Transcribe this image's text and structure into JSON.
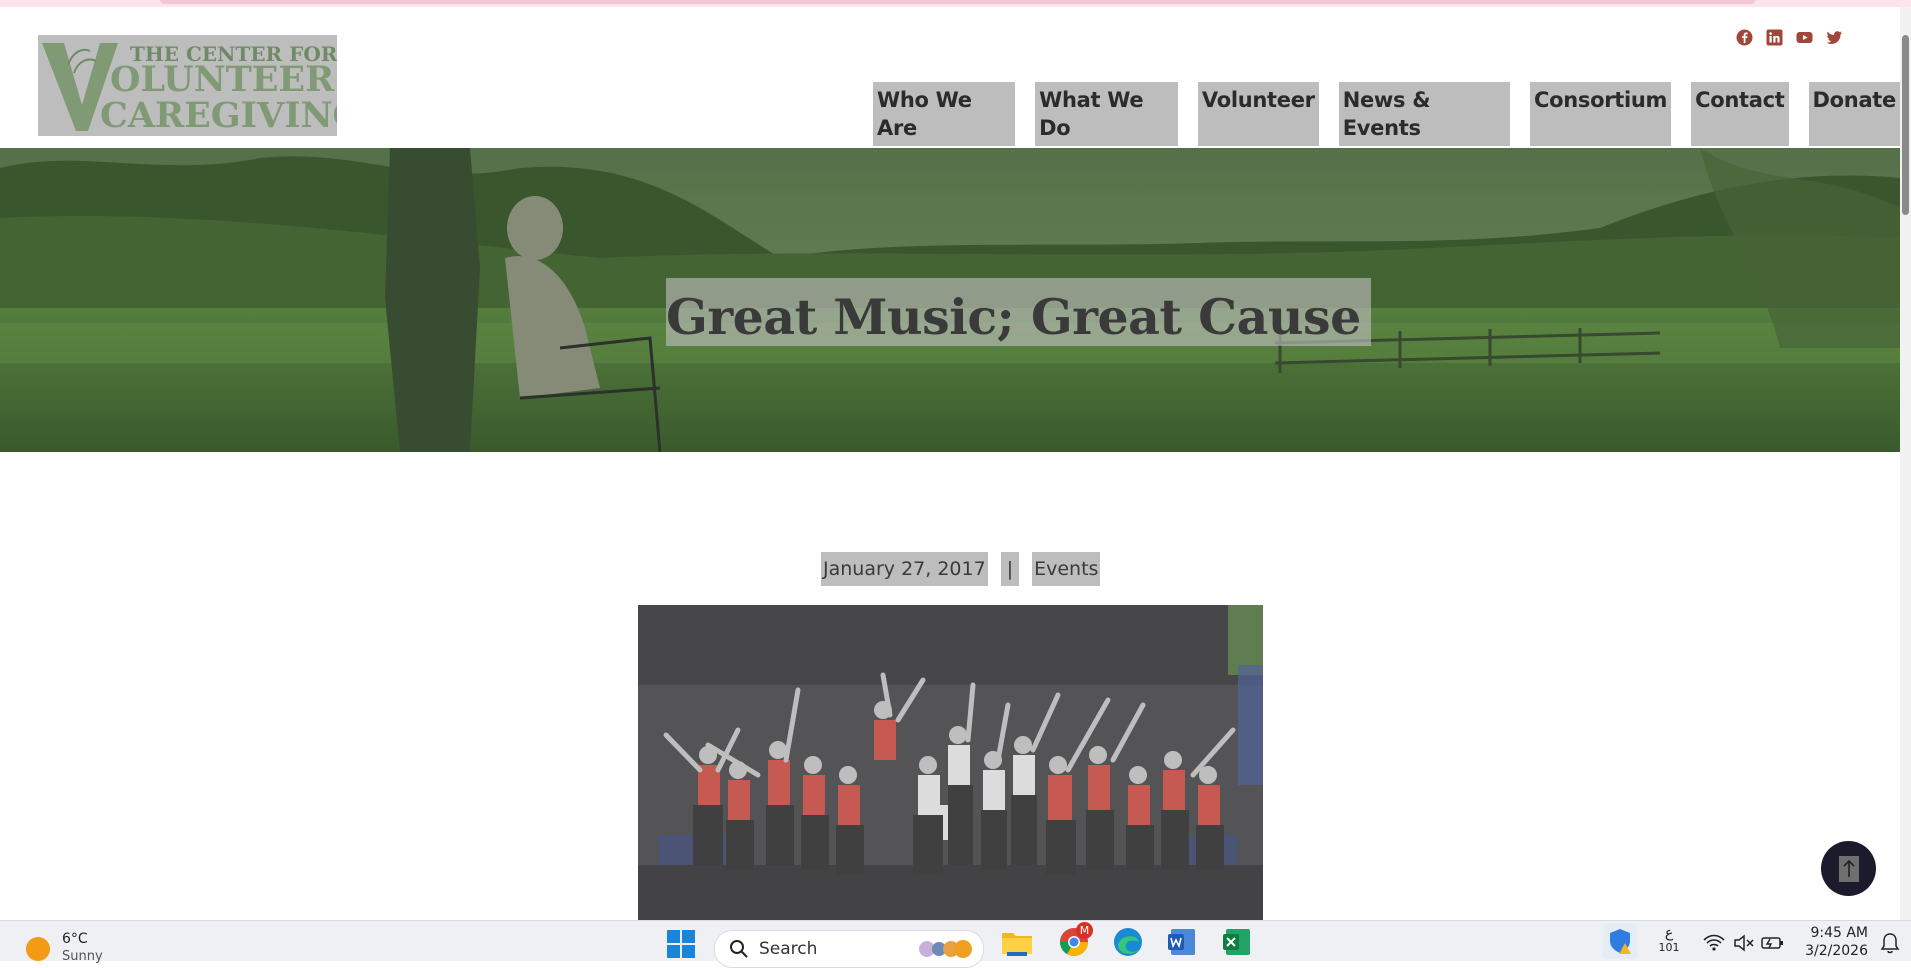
{
  "site": {
    "logo_alt": "THE CENTER FOR VOLUNTEER CAREGIVING",
    "logo_lines": [
      "THE CENTER FOR",
      "OLUNTEER",
      "CAREGIVING"
    ],
    "social": [
      "facebook-icon",
      "linkedin-icon",
      "youtube-icon",
      "twitter-icon"
    ],
    "social_color": "#a0463a"
  },
  "nav": {
    "items": [
      {
        "label": "Who We Are"
      },
      {
        "label": "What We Do"
      },
      {
        "label": "Volunteer"
      },
      {
        "label": "News & Events"
      },
      {
        "label": "Consortium"
      },
      {
        "label": "Contact"
      },
      {
        "label": "Donate"
      }
    ]
  },
  "hero": {
    "title": "Great Music; Great Cause"
  },
  "post": {
    "date": "January 27, 2017",
    "separator": "|",
    "category": "Events"
  },
  "taskbar": {
    "weather_temp": "6°C",
    "weather_desc": "Sunny",
    "search_placeholder": "Search",
    "time": "9:45 AM",
    "date": "3/2/2026",
    "lang_top": "ع",
    "lang_bottom": "101",
    "chrome_badge": "M"
  }
}
